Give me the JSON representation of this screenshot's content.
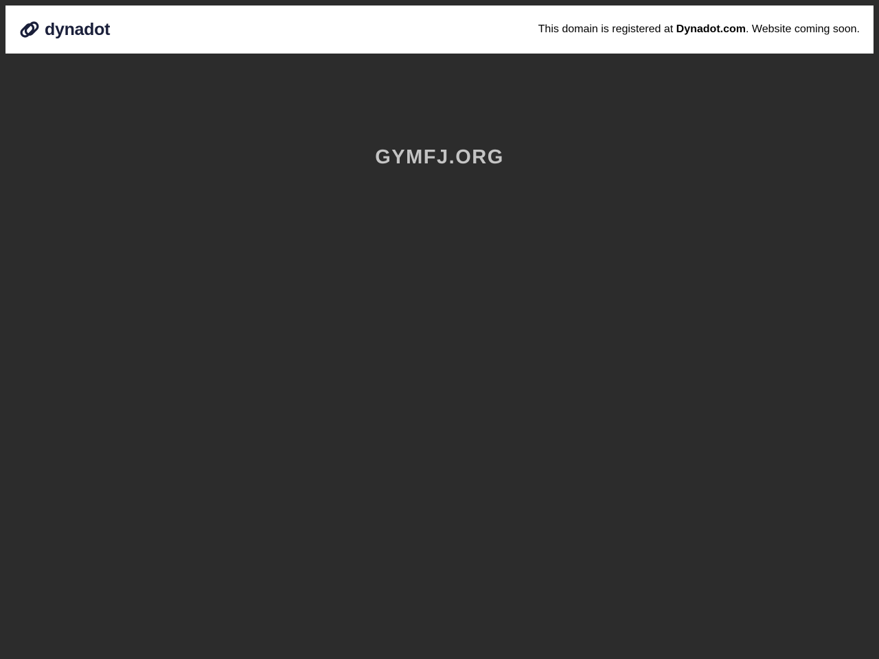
{
  "header": {
    "brand_name": "dynadot",
    "brand_icon": "chain-link-icon",
    "brand_color": "#1a1f3a",
    "notice_prefix": "This domain is registered at ",
    "notice_link": "Dynadot.com",
    "notice_suffix": ". Website coming soon."
  },
  "main": {
    "domain": "GYMFJ.ORG",
    "background_color": "#2c2c2c",
    "domain_color": "#c4c4c4"
  }
}
